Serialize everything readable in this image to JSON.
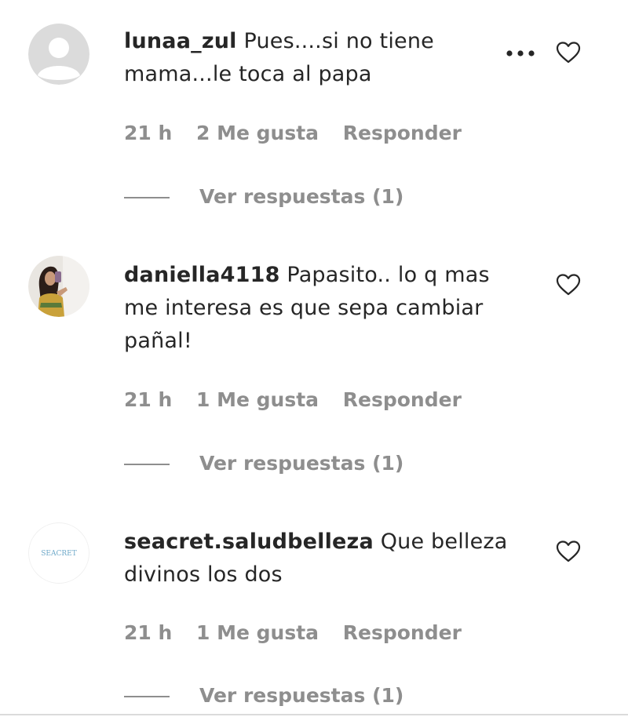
{
  "comments": [
    {
      "username": "lunaa_zul",
      "text": "Pues....si no tiene mama...le toca al papa",
      "time": "21 h",
      "likes": "2 Me gusta",
      "reply": "Responder",
      "view_replies": "Ver respuestas (1)"
    },
    {
      "username": "daniella4118",
      "text": "Papasito.. lo q mas me interesa es que sepa cambiar pañal!",
      "time": "21 h",
      "likes": "1 Me gusta",
      "reply": "Responder",
      "view_replies": "Ver respuestas (1)"
    },
    {
      "username": "seacret.saludbelleza",
      "avatar_text": "SEACRET",
      "text": "Que belleza divinos los dos",
      "time": "21 h",
      "likes": "1 Me gusta",
      "reply": "Responder",
      "view_replies": "Ver respuestas (1)"
    }
  ],
  "icons": {
    "like": "heart-outline-icon",
    "options": "more-options-icon"
  },
  "colors": {
    "text": "#262626",
    "secondary": "#8e8e8e",
    "avatar_placeholder": "#dbdbdb"
  }
}
